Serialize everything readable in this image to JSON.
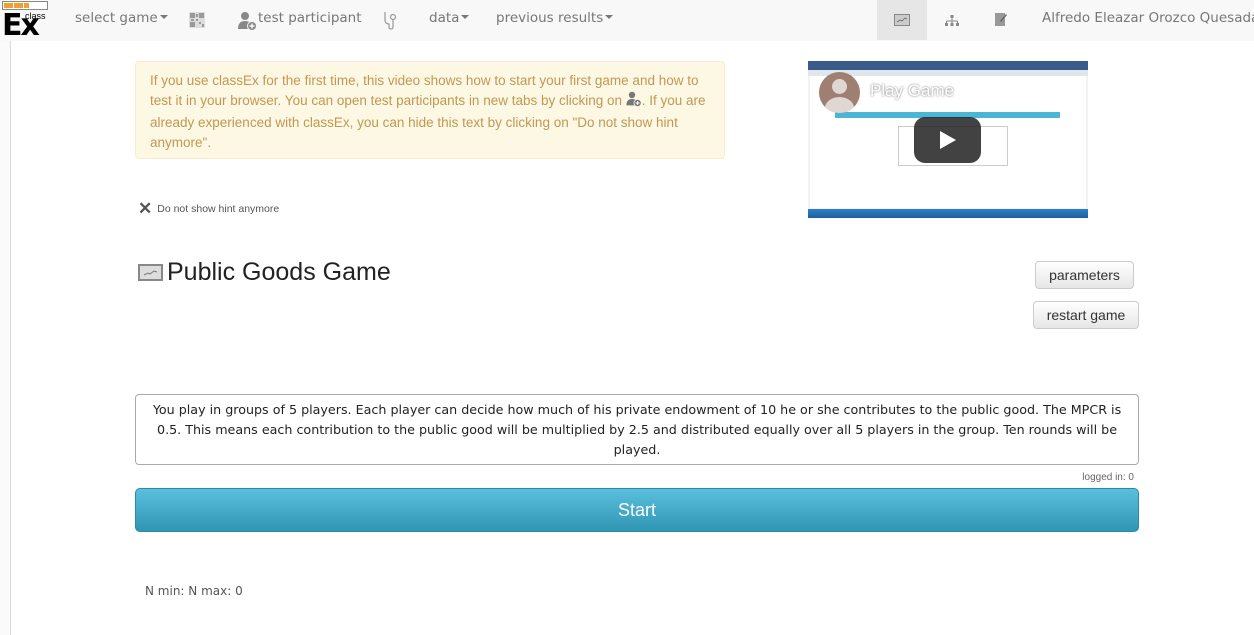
{
  "navbar": {
    "logo": {
      "text": "Ex",
      "superscript": "class",
      "progress_fraction": 0.6
    },
    "select_game": "select game",
    "qr_icon": "qr-code-icon",
    "test_participant": "test participant",
    "stethoscope_icon": "stethoscope-icon",
    "data": "data",
    "previous_results": "previous results",
    "view_icons": [
      "chart-icon",
      "hierarchy-icon",
      "edit-note-icon"
    ],
    "active_view": "chart-icon",
    "user_name": "Alfredo Eleazar Orozco Quesada"
  },
  "hint": {
    "text_part1": "If you use classEx for the first time, this video shows how to start your first game and how to test it in your browser. You can open test participants in new tabs by clicking on ",
    "text_part2": ". If you are already experienced with classEx, you can hide this text by clicking on \"Do not show hint anymore\".",
    "dismiss_label": "Do not show hint anymore"
  },
  "video": {
    "title": "Play Game",
    "play_icon": "play-icon"
  },
  "game": {
    "title": "Public Goods Game",
    "parameters_label": "parameters",
    "restart_label": "restart game",
    "description": "You play in groups of 5 players. Each player can decide how much of his private endowment of 10 he or she contributes to the public good. The MPCR is 0.5. This means each contribution to the public good will be multiplied by 2.5 and distributed equally over all 5 players in the group. Ten rounds will be played.",
    "logged_in": "logged in: 0",
    "start_label": "Start",
    "n_minmax": "N min: N max: 0"
  },
  "colors": {
    "start_button": "#5bc0de",
    "hint_background": "#fcf8e3",
    "hint_text": "#c09853"
  }
}
